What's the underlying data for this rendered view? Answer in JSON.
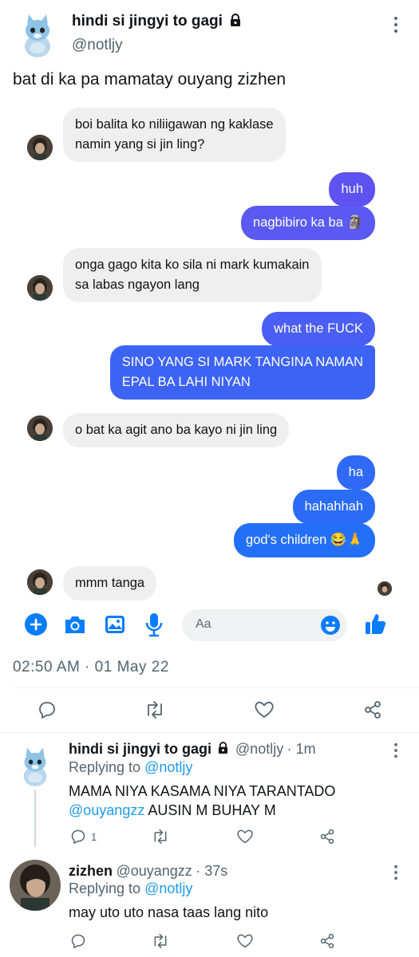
{
  "tweet": {
    "author_name": "hindi si jingyi to gagi",
    "author_handle": "@notljy",
    "text": "bat di ka pa mamatay ouyang zizhen",
    "timestamp": "02:50 AM · 01 May 22"
  },
  "chat": {
    "messages": [
      {
        "side": "in",
        "lines": [
          "boi balita ko niliigawan ng kaklase",
          "namin yang si jin ling?"
        ]
      },
      {
        "side": "out",
        "lines": [
          "huh"
        ]
      },
      {
        "side": "out",
        "lines": [
          "nagbibiro ka ba 🗿"
        ]
      },
      {
        "side": "in",
        "lines": [
          "onga gago kita ko sila ni mark kumakain",
          "sa labas ngayon lang"
        ]
      },
      {
        "side": "out",
        "lines": [
          "what the FUCK"
        ]
      },
      {
        "side": "out",
        "lines": [
          "SINO YANG SI MARK TANGINA NAMAN",
          "EPAL BA LAHI NIYAN"
        ]
      },
      {
        "side": "in",
        "lines": [
          "o bat ka agit ano ba kayo ni jin ling"
        ]
      },
      {
        "side": "out",
        "lines": [
          "ha"
        ]
      },
      {
        "side": "out",
        "lines": [
          "hahahhah"
        ]
      },
      {
        "side": "out",
        "lines": [
          "god's children 😂🙏"
        ]
      },
      {
        "side": "in",
        "lines": [
          "mmm tanga"
        ]
      }
    ],
    "composer_placeholder": "Aa",
    "colors": {
      "accent": "#0a7cff",
      "purple": "#6b4cf6",
      "blue": "#1f6cf5"
    }
  },
  "replies": [
    {
      "name": "hindi si jingyi to gagi",
      "handle": "@notljy",
      "time": "· 1m",
      "replying_label": "Replying to",
      "replying_to": "@notljy",
      "mention": "@ouyangzz",
      "line1": "MAMA NIYA KASAMA NIYA TARANTADO",
      "line2_rest": " AUSIN M BUHAY M",
      "reply_count": "1"
    },
    {
      "name": "zizhen",
      "handle": "@ouyangzz",
      "time": "· 37s",
      "replying_label": "Replying to",
      "replying_to": "@notljy",
      "text": "may uto uto nasa taas lang nito"
    }
  ],
  "icons": [
    "lock-icon",
    "more-icon",
    "plus-icon",
    "camera-icon",
    "image-icon",
    "mic-icon",
    "emoji-icon",
    "like-thumb-icon",
    "reply-icon",
    "retweet-icon",
    "heart-icon",
    "share-icon"
  ]
}
